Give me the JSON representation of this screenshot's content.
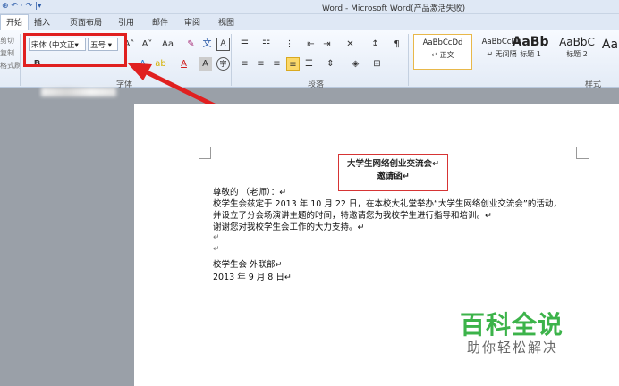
{
  "window": {
    "title": "Word - Microsoft Word(产品激活失败)"
  },
  "quick_access": {
    "icons": [
      "save-icon",
      "undo-icon",
      "redo-icon"
    ],
    "text": "⊕ ↶ · ↷ |▾"
  },
  "tabs": [
    {
      "label": "开始"
    },
    {
      "label": "插入"
    },
    {
      "label": "页面布局"
    },
    {
      "label": "引用"
    },
    {
      "label": "邮件"
    },
    {
      "label": "审阅"
    },
    {
      "label": "视图"
    }
  ],
  "clipboard": {
    "cut": "剪切",
    "copy": "复制",
    "format": "格式刷"
  },
  "font": {
    "name_value": "宋体 (中文正▾",
    "size_value": "五号 ▾",
    "group_label": "字体"
  },
  "paragraph": {
    "group_label": "段落"
  },
  "styles": {
    "group_label": "样式",
    "items": [
      {
        "sample": "AaBbCcDd",
        "name": "↵ 正文"
      },
      {
        "sample": "AaBbCcDd",
        "name": "↵ 无间隔"
      },
      {
        "sample": "AaBb",
        "name": "标题 1"
      },
      {
        "sample": "AaBbC",
        "name": "标题 2"
      },
      {
        "sample": "Aa",
        "name": ""
      }
    ]
  },
  "document": {
    "title_line1": "大学生网络创业交流会↵",
    "title_line2": "邀请函↵",
    "lines": [
      "尊敬的             （老师）：↵",
      "校学生会兹定于 2013 年 10 月 22 日，在本校大礼堂举办“大学生网络创业交流会”的活动，",
      "并设立了分会场演讲主题的时间，特邀请您为我校学生进行指导和培训。↵",
      "谢谢您对我校学生会工作的大力支持。↵",
      "↵",
      "↵",
      "校学生会  外联部↵",
      "2013 年 9 月 8 日↵"
    ]
  },
  "watermark": {
    "brand": "百科全说",
    "slogan": "助你轻松解决"
  },
  "colors": {
    "highlight": "#e02020",
    "watermark": "#3cb34a"
  }
}
